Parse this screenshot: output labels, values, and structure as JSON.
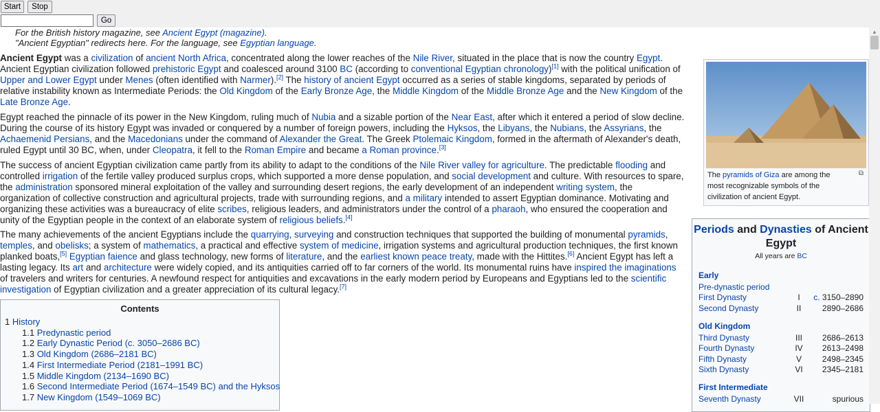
{
  "toolbar": {
    "start_label": "Start",
    "stop_label": "Stop",
    "go_label": "Go",
    "url_value": ""
  },
  "hatnotes": {
    "line1_prefix": "For the British history magazine, see ",
    "line1_link": "Ancient Egypt (magazine)",
    "line1_suffix": ".",
    "line2_prefix": "\"Ancient Egyptian\" redirects here. For the language, see ",
    "line2_link": "Egyptian language",
    "line2_suffix": "."
  },
  "paragraphs": [
    [
      {
        "b": "Ancient Egypt"
      },
      {
        "t": " was a "
      },
      {
        "a": "civilization"
      },
      {
        "t": " of "
      },
      {
        "a": "ancient North Africa"
      },
      {
        "t": ", concentrated along the lower reaches of the "
      },
      {
        "a": "Nile River"
      },
      {
        "t": ", situated in the place that is now the country "
      },
      {
        "a": "Egypt"
      },
      {
        "t": ". Ancient Egyptian civilization followed "
      },
      {
        "a": "prehistoric Egypt"
      },
      {
        "t": " and coalesced around 3100 "
      },
      {
        "a": "BC"
      },
      {
        "t": " (according to "
      },
      {
        "a": "conventional Egyptian chronology"
      },
      {
        "t": ")"
      },
      {
        "s": "[1]"
      },
      {
        "t": " with the political unification of "
      },
      {
        "a": "Upper and Lower Egypt"
      },
      {
        "t": " under "
      },
      {
        "a": "Menes"
      },
      {
        "t": " (often identified with "
      },
      {
        "a": "Narmer"
      },
      {
        "t": ")."
      },
      {
        "s": "[2]"
      },
      {
        "t": " The "
      },
      {
        "a": "history of ancient Egypt"
      },
      {
        "t": " occurred as a series of stable kingdoms, separated by periods of relative instability known as Intermediate Periods: the "
      },
      {
        "a": "Old Kingdom"
      },
      {
        "t": " of the "
      },
      {
        "a": "Early Bronze Age"
      },
      {
        "t": ", the "
      },
      {
        "a": "Middle Kingdom"
      },
      {
        "t": " of the "
      },
      {
        "a": "Middle Bronze Age"
      },
      {
        "t": " and the "
      },
      {
        "a": "New Kingdom"
      },
      {
        "t": " of the "
      },
      {
        "a": "Late Bronze Age"
      },
      {
        "t": "."
      }
    ],
    [
      {
        "t": "Egypt reached the pinnacle of its power in the New Kingdom, ruling much of "
      },
      {
        "a": "Nubia"
      },
      {
        "t": " and a sizable portion of the "
      },
      {
        "a": "Near East"
      },
      {
        "t": ", after which it entered a period of slow decline. During the course of its history Egypt was invaded or conquered by a number of foreign powers, including the "
      },
      {
        "a": "Hyksos"
      },
      {
        "t": ", the "
      },
      {
        "a": "Libyans"
      },
      {
        "t": ", the "
      },
      {
        "a": "Nubians"
      },
      {
        "t": ", the "
      },
      {
        "a": "Assyrians"
      },
      {
        "t": ", the "
      },
      {
        "a": "Achaemenid Persians"
      },
      {
        "t": ", and the "
      },
      {
        "a": "Macedonians"
      },
      {
        "t": " under the command of "
      },
      {
        "a": "Alexander the Great"
      },
      {
        "t": ". The Greek "
      },
      {
        "a": "Ptolemaic Kingdom"
      },
      {
        "t": ", formed in the aftermath of Alexander's death, ruled Egypt until 30 BC, when, under "
      },
      {
        "a": "Cleopatra"
      },
      {
        "t": ", it fell to the "
      },
      {
        "a": "Roman Empire"
      },
      {
        "t": " and became "
      },
      {
        "a": "a Roman province"
      },
      {
        "t": "."
      },
      {
        "s": "[3]"
      }
    ],
    [
      {
        "t": "The success of ancient Egyptian civilization came partly from its ability to adapt to the conditions of the "
      },
      {
        "a": "Nile River valley for agriculture"
      },
      {
        "t": ". The predictable "
      },
      {
        "a": "flooding"
      },
      {
        "t": " and controlled "
      },
      {
        "a": "irrigation"
      },
      {
        "t": " of the fertile valley produced surplus crops, which supported a more dense population, and "
      },
      {
        "a": "social development"
      },
      {
        "t": " and culture. With resources to spare, the "
      },
      {
        "a": "administration"
      },
      {
        "t": " sponsored mineral exploitation of the valley and surrounding desert regions, the early development of an independent "
      },
      {
        "a": "writing system"
      },
      {
        "t": ", the organization of collective construction and agricultural projects, trade with surrounding regions, and "
      },
      {
        "a": "a military"
      },
      {
        "t": " intended to assert Egyptian dominance. Motivating and organizing these activities was a bureaucracy of elite "
      },
      {
        "a": "scribes"
      },
      {
        "t": ", religious leaders, and administrators under the control of a "
      },
      {
        "a": "pharaoh"
      },
      {
        "t": ", who ensured the cooperation and unity of the Egyptian people in the context of an elaborate system of "
      },
      {
        "a": "religious beliefs"
      },
      {
        "t": "."
      },
      {
        "s": "[4]"
      }
    ],
    [
      {
        "t": "The many achievements of the ancient Egyptians include the "
      },
      {
        "a": "quarrying"
      },
      {
        "t": ", "
      },
      {
        "a": "surveying"
      },
      {
        "t": " and construction techniques that supported the building of monumental "
      },
      {
        "a": "pyramids"
      },
      {
        "t": ", "
      },
      {
        "a": "temples"
      },
      {
        "t": ", and "
      },
      {
        "a": "obelisks"
      },
      {
        "t": "; a system of "
      },
      {
        "a": "mathematics"
      },
      {
        "t": ", a practical and effective "
      },
      {
        "a": "system of medicine"
      },
      {
        "t": ", irrigation systems and agricultural production techniques, the first known planked boats,"
      },
      {
        "s": "[5]"
      },
      {
        "t": " "
      },
      {
        "a": "Egyptian faience"
      },
      {
        "t": " and glass technology, new forms of "
      },
      {
        "a": "literature"
      },
      {
        "t": ", and the "
      },
      {
        "a": "earliest known peace treaty"
      },
      {
        "t": ", made with the Hittites."
      },
      {
        "s": "[6]"
      },
      {
        "t": " Ancient Egypt has left a lasting legacy. Its "
      },
      {
        "a": "art"
      },
      {
        "t": " and "
      },
      {
        "a": "architecture"
      },
      {
        "t": " were widely copied, and its antiquities carried off to far corners of the world. Its monumental ruins have "
      },
      {
        "a": "inspired the imaginations"
      },
      {
        "t": " of travelers and writers for centuries. A newfound respect for antiquities and excavations in the early modern period by Europeans and Egyptians led to the "
      },
      {
        "a": "scientific investigation"
      },
      {
        "t": " of Egyptian civilization and a greater appreciation of its cultural legacy."
      },
      {
        "s": "[7]"
      }
    ]
  ],
  "infobox_image": {
    "caption": [
      {
        "t": "The "
      },
      {
        "a": "pyramids of Giza"
      },
      {
        "t": " are among the most recognizable symbols of the civilization of ancient Egypt."
      }
    ]
  },
  "periods_box": {
    "title_a": "Periods",
    "title_and": " and ",
    "title_b": "Dynasties",
    "title_rest": " of Ancient Egypt",
    "subtitle_prefix": "All years are ",
    "subtitle_link": "BC",
    "groups": [
      {
        "heading": "Early",
        "rows": [
          {
            "name": "Pre-dynastic period",
            "num": "",
            "date": ""
          },
          {
            "name": "First Dynasty",
            "num": "I",
            "date": "c. 3150–2890",
            "date_link": "c."
          },
          {
            "name": "Second Dynasty",
            "num": "II",
            "date": "2890–2686"
          }
        ]
      },
      {
        "heading": "Old Kingdom",
        "rows": [
          {
            "name": "Third Dynasty",
            "num": "III",
            "date": "2686–2613"
          },
          {
            "name": "Fourth Dynasty",
            "num": "IV",
            "date": "2613–2498"
          },
          {
            "name": "Fifth Dynasty",
            "num": "V",
            "date": "2498–2345"
          },
          {
            "name": "Sixth Dynasty",
            "num": "VI",
            "date": "2345–2181"
          }
        ]
      },
      {
        "heading": "First Intermediate",
        "rows": [
          {
            "name": "Seventh Dynasty",
            "num": "VII",
            "date": "spurious"
          }
        ]
      }
    ]
  },
  "toc": {
    "title": "Contents",
    "items": [
      {
        "num": "1",
        "label": "History",
        "level": 1
      },
      {
        "num": "1.1",
        "label": "Predynastic period",
        "level": 2
      },
      {
        "num": "1.2",
        "label": "Early Dynastic Period (c. 3050–2686 BC)",
        "level": 2
      },
      {
        "num": "1.3",
        "label": "Old Kingdom (2686–2181 BC)",
        "level": 2
      },
      {
        "num": "1.4",
        "label": "First Intermediate Period (2181–1991 BC)",
        "level": 2
      },
      {
        "num": "1.5",
        "label": "Middle Kingdom (2134–1690 BC)",
        "level": 2
      },
      {
        "num": "1.6",
        "label": "Second Intermediate Period (1674–1549 BC) and the Hyksos",
        "level": 2
      },
      {
        "num": "1.7",
        "label": "New Kingdom (1549–1069 BC)",
        "level": 2
      }
    ]
  },
  "icons": {
    "enlarge": "enlarge-icon",
    "scroll_up": "scroll-up-arrow-icon"
  },
  "colors": {
    "link": "#0645ad",
    "text": "#202122",
    "toolbar_bg": "#f0f0f0",
    "box_bg": "#f8f9fa",
    "box_border": "#a2a9b1"
  }
}
